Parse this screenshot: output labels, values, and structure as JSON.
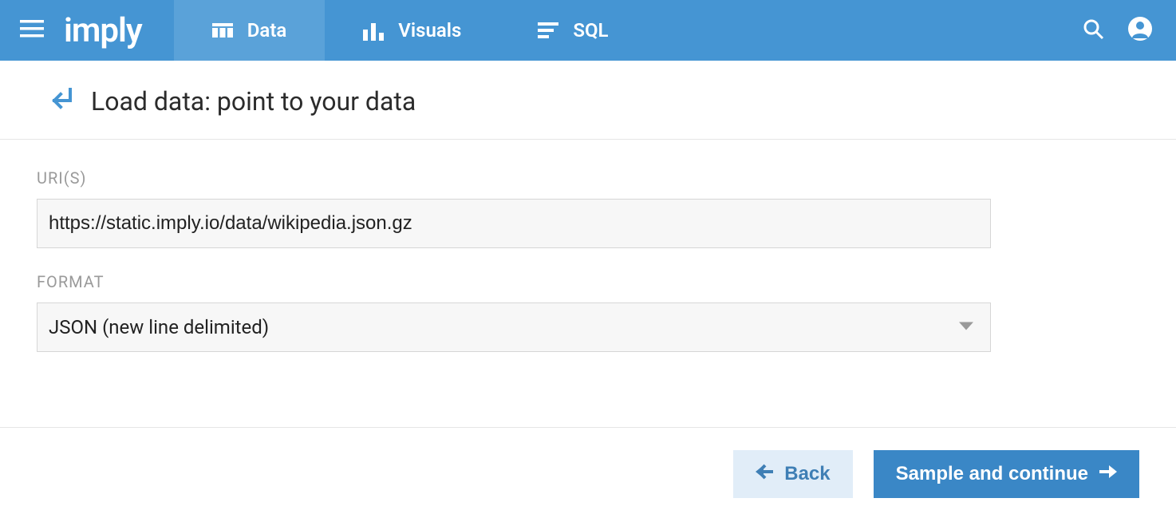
{
  "brand": "imply",
  "nav": {
    "tabs": [
      {
        "label": "Data",
        "active": true
      },
      {
        "label": "Visuals",
        "active": false
      },
      {
        "label": "SQL",
        "active": false
      }
    ]
  },
  "page": {
    "title": "Load data: point to your data"
  },
  "form": {
    "uri_label": "URI(S)",
    "uri_value": "https://static.imply.io/data/wikipedia.json.gz",
    "format_label": "FORMAT",
    "format_value": "JSON (new line delimited)"
  },
  "footer": {
    "back_label": "Back",
    "continue_label": "Sample and continue"
  }
}
